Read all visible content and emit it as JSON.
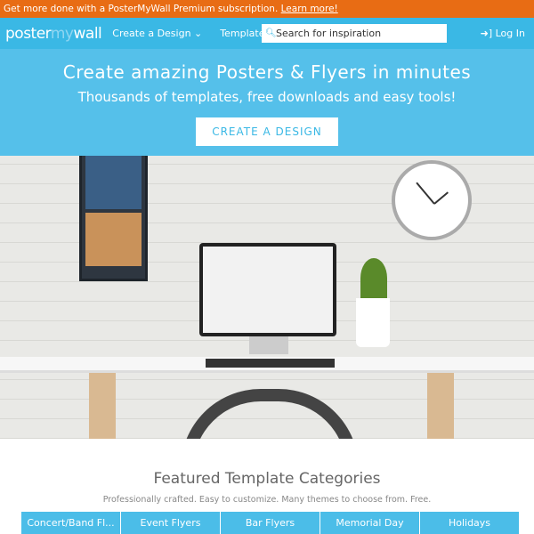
{
  "promo": {
    "text": "Get more done with a PosterMyWall Premium subscription.",
    "link": "Learn more!"
  },
  "nav": {
    "logo_a": "poster",
    "logo_b": "my",
    "logo_c": "wall",
    "create": "Create a Design ⌄",
    "templates": "Templates ⌄",
    "search_placeholder": "Search for inspiration",
    "login": "Log In"
  },
  "hero": {
    "title": "Create amazing Posters & Flyers in minutes",
    "subtitle": "Thousands of templates, free downloads and easy tools!",
    "cta": "CREATE A DESIGN"
  },
  "featured": {
    "title": "Featured Template Categories",
    "subtitle": "Professionally crafted. Easy to customize. Many themes to choose from. Free.",
    "categories": [
      "Concert/Band Fl...",
      "Event Flyers",
      "Bar Flyers",
      "Memorial Day",
      "Holidays"
    ]
  },
  "colors": {
    "promo": "#e86c14",
    "nav": "#3ab8e5",
    "hero": "#55c0ea"
  }
}
